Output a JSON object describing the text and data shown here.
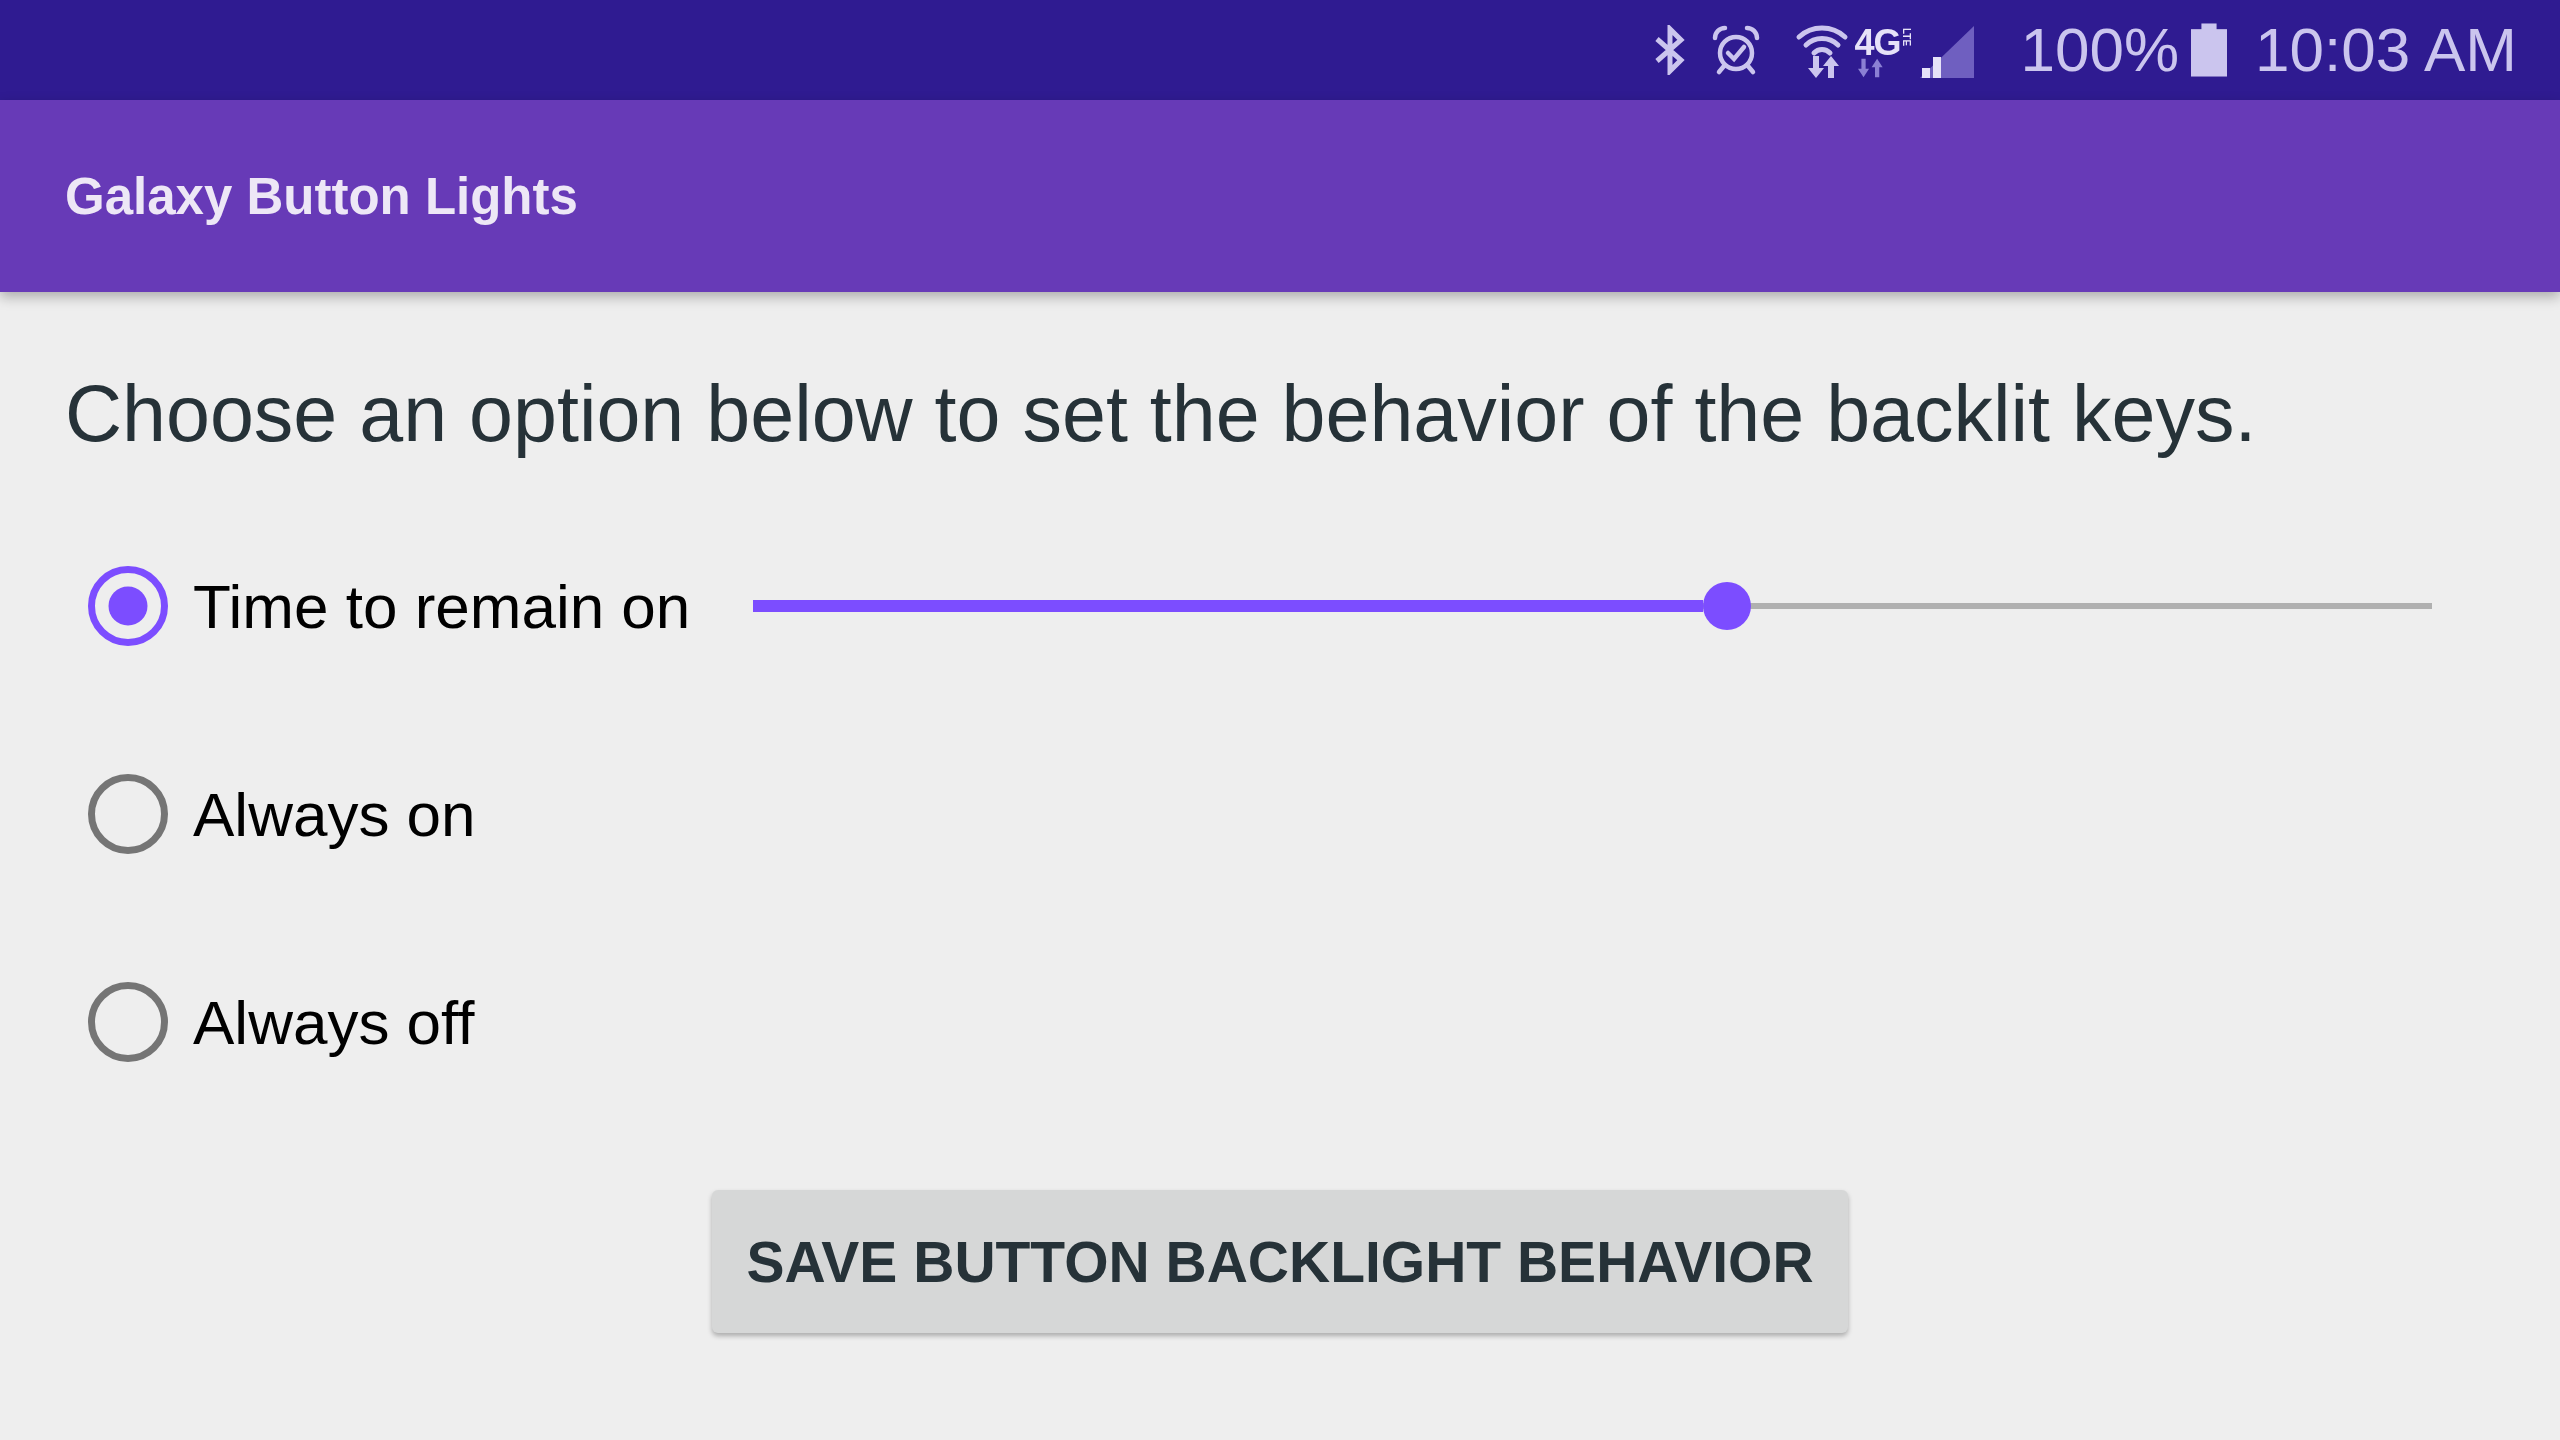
{
  "status_bar": {
    "network": {
      "type": "4G",
      "badge": "LTE"
    },
    "battery": "100%",
    "time": "10:03 AM"
  },
  "app_bar": {
    "title": "Galaxy Button Lights"
  },
  "prompt": "Choose an option below to set the behavior of the backlit keys.",
  "options": [
    {
      "kind": "slider",
      "label": "Time to remain on",
      "selected": true,
      "slider": {
        "level": 0.58
      }
    },
    {
      "kind": "plain",
      "label": "Always on",
      "selected": false
    },
    {
      "kind": "plain",
      "label": "Always off",
      "selected": false
    }
  ],
  "save_button": "SAVE BUTTON BACKLIGHT BEHAVIOR"
}
